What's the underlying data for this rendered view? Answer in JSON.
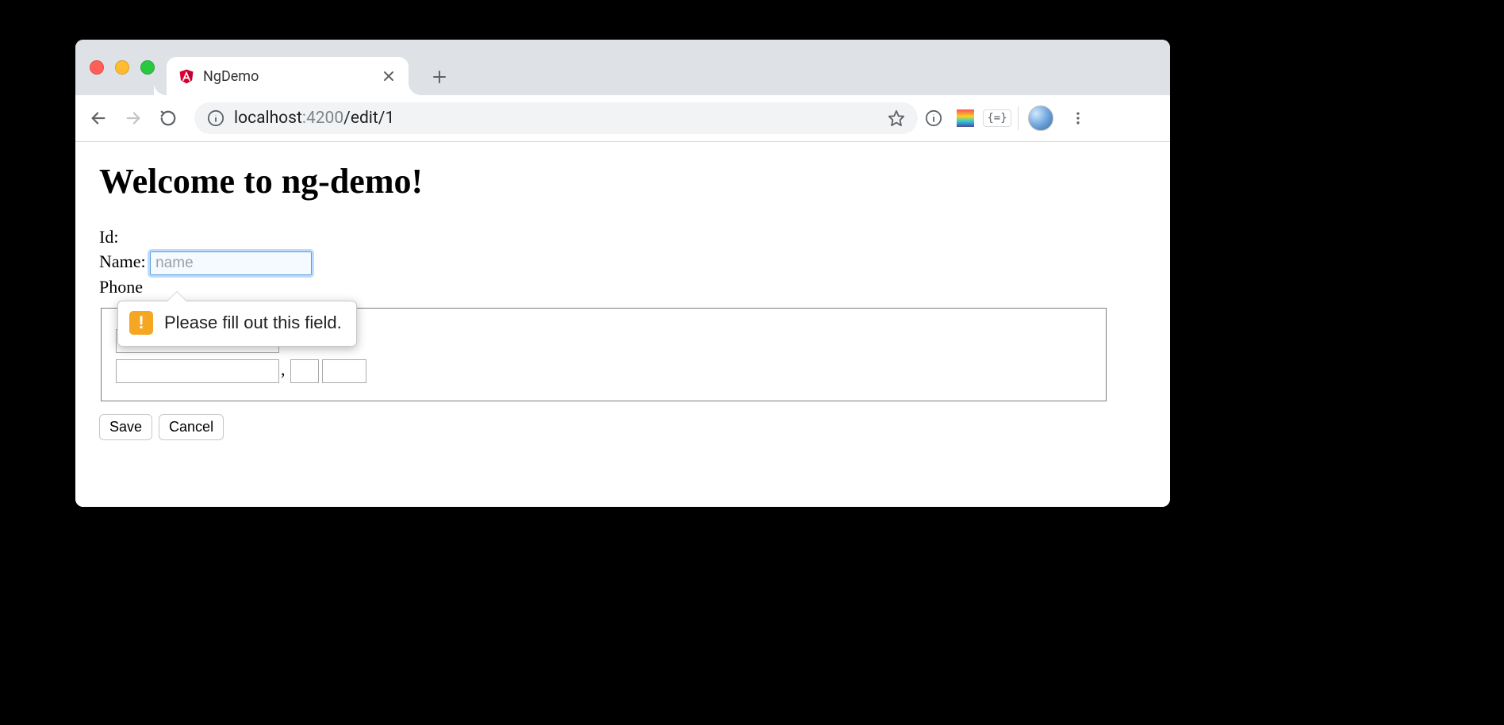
{
  "browser": {
    "tab_title": "NgDemo",
    "url_host": "localhost",
    "url_port": ":4200",
    "url_path": "/edit/1",
    "ext_braces_label": "{=}"
  },
  "page": {
    "heading": "Welcome to ng-demo!",
    "labels": {
      "id": "Id:",
      "name": "Name:",
      "phone": "Phone",
      "comma": ","
    },
    "name_placeholder": "name",
    "buttons": {
      "save": "Save",
      "cancel": "Cancel"
    }
  },
  "validation": {
    "message": "Please fill out this field.",
    "mark": "!"
  }
}
